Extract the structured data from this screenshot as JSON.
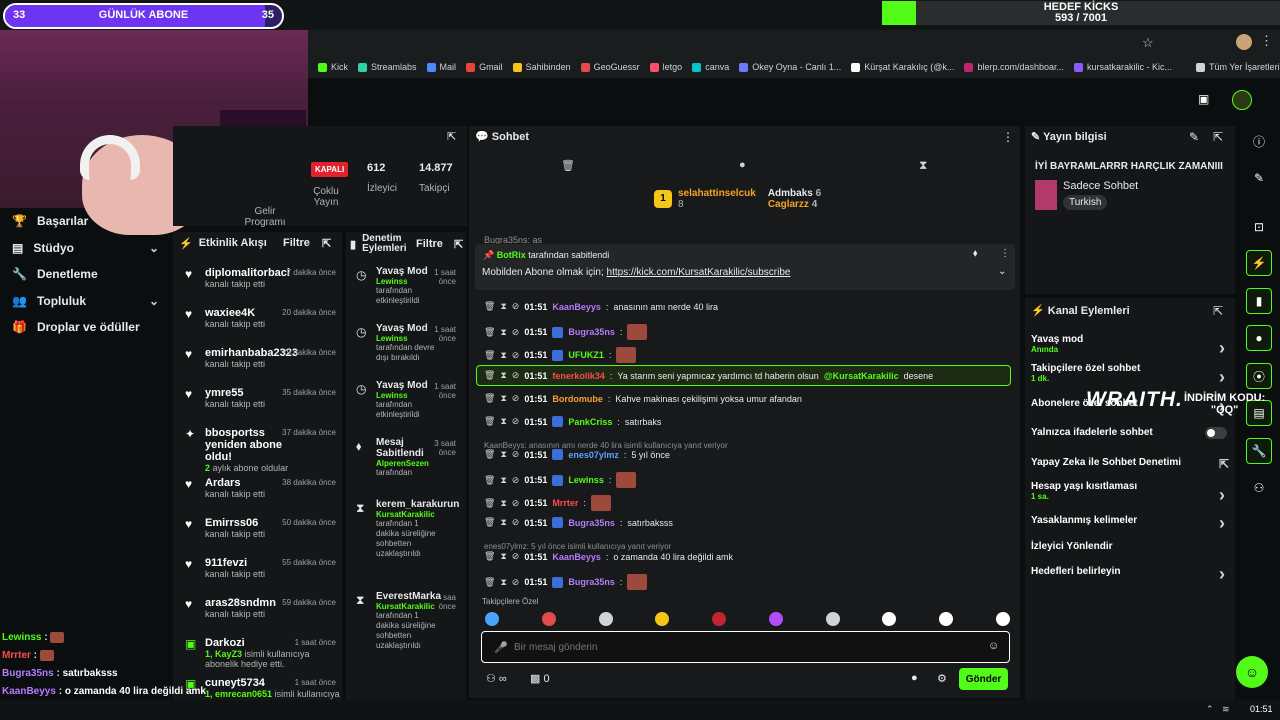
{
  "goal": {
    "title": "GÜNLÜK ABONE",
    "left": "33",
    "right": "35",
    "progress": 0.94
  },
  "kicks": {
    "title": "HEDEF KİCKS",
    "value": "593 / 7001",
    "progress": 0.085
  },
  "bookmarks": [
    "Kick",
    "Streamlabs",
    "Mail",
    "Gmail",
    "Sahibinden",
    "GeoGuessr",
    "letgo",
    "canva",
    "Okey Oyna - Canlı 1...",
    "Kürşat Karakılıç (@k...",
    "blerp.com/dashboar...",
    "kursatkarakilic - Kic...",
    "Tüm Yer İşaretleri"
  ],
  "stats": {
    "status": "KAPALI",
    "viewers": "612",
    "viewers_label": "İzleyici",
    "followers": "14.877",
    "followers_label": "Takipçi",
    "multi": "Çoklu Yayın",
    "income": "Gelir Programı"
  },
  "nav": [
    {
      "label": "Başarılar"
    },
    {
      "label": "Stüdyo"
    },
    {
      "label": "Denetleme"
    },
    {
      "label": "Topluluk"
    },
    {
      "label": "Droplar ve ödüller"
    }
  ],
  "events": {
    "title": "Etkinlik Akışı",
    "filter": "Filtre",
    "items": [
      {
        "name": "diplomalitorbaci",
        "sub": "kanalı takip etti",
        "time": "7 dakika önce"
      },
      {
        "name": "waxiee4K",
        "sub": "kanalı takip etti",
        "time": "20 dakika önce"
      },
      {
        "name": "emirhanbaba2323",
        "sub": "kanalı takip etti",
        "time": "29 dakika önce"
      },
      {
        "name": "ymre55",
        "sub": "kanalı takip etti",
        "time": "35 dakika önce"
      },
      {
        "name": "bbosportss yeniden abone oldu!",
        "sub": "aylık abone oldular",
        "sub_num": "2",
        "time": "37 dakika önce"
      },
      {
        "name": "Ardars",
        "sub": "kanalı takip etti",
        "time": "38 dakika önce"
      },
      {
        "name": "Emirrss06",
        "sub": "kanalı takip etti",
        "time": "50 dakika önce"
      },
      {
        "name": "911fevzi",
        "sub": "kanalı takip etti",
        "time": "55 dakika önce"
      },
      {
        "name": "aras28sndmn",
        "sub": "kanalı takip etti",
        "time": "59 dakika önce"
      },
      {
        "name": "Darkozi",
        "sub": "isimli kullanıcıya abonelik hediye etti.",
        "sub_num": "1, KayZ3",
        "time": "1 saat önce"
      },
      {
        "name": "cuneyt5734",
        "sub": "isimli kullanıcıya abonelik hediye etti.",
        "sub_num": "1, emrecan0651",
        "time": "1 saat önce"
      }
    ]
  },
  "mod": {
    "title": "Denetim Eylemleri",
    "filter": "Filtre",
    "items": [
      {
        "name": "Yavaş Mod",
        "user": "Lewinss",
        "sub": "tarafından etkinleştirildi",
        "time": "1 saat önce"
      },
      {
        "name": "Yavaş Mod",
        "user": "Lewinss",
        "sub": "tarafından devre dışı bırakıldı",
        "time": "1 saat önce"
      },
      {
        "name": "Yavaş Mod",
        "user": "Lewinss",
        "sub": "tarafından etkinleştirildi",
        "time": "1 saat önce"
      },
      {
        "name": "Mesaj Sabitlendi",
        "user": "AlperenSezen",
        "sub": "tarafından",
        "time": "3 saat önce"
      },
      {
        "name": "kerem_karakurun",
        "user": "KursatKarakilic",
        "sub": "tarafından 1 dakika süreliğine sohbetten uzaklaştırıldı",
        "time": ""
      },
      {
        "name": "EverestMarka",
        "user": "KursatKarakilic",
        "sub": "tarafından 1 dakika süreliğine sohbetten uzaklaştırıldı",
        "time": "saa önce"
      }
    ]
  },
  "chat": {
    "title": "Sohbet",
    "top_users": [
      {
        "name": "selahattinselcuk",
        "count": "8"
      },
      {
        "name": "Admbaks",
        "count": "6"
      },
      {
        "name": "Caglarzz",
        "count": "4"
      }
    ],
    "pinned": {
      "by": "BotRix",
      "by_label": "tarafından sabitlendi",
      "text": "Mobilden Abone olmak için;",
      "link": "https://kick.com/KursatKarakilic/subscribe"
    },
    "ghost": "Bugra35ns: as",
    "messages": [
      {
        "time": "01:51",
        "user": "KaanBeyys",
        "color": "#b57cff",
        "text": "anasının amı nerde 40 lira",
        "emote": false
      },
      {
        "time": "01:51",
        "user": "Bugra35ns",
        "color": "#b57cff",
        "text": "",
        "emote": true
      },
      {
        "time": "01:51",
        "user": "UFUKZ1",
        "color": "#53fc18",
        "text": "",
        "emote": true
      },
      {
        "time": "01:51",
        "user": "fenerkolik34",
        "color": "#ff4b4b",
        "text": "Ya starım seni yapmıcaz yardımcı td haberin olsun",
        "mention": "@KursatKarakilic",
        "tail": "desene",
        "highlight": true
      },
      {
        "time": "01:51",
        "user": "Bordomube",
        "color": "#ff9f2e",
        "text": "Kahve makinası çekilişimi yoksa umur afandan"
      },
      {
        "time": "01:51",
        "user": "PankCriss",
        "color": "#53fc18",
        "text": "satırbaks"
      },
      {
        "time": "01:51",
        "user": "enes07ylmz",
        "color": "#5aa3ff",
        "text": "5 yıl önce",
        "reply": "KaanBeyys: anasının amı nerde 40 lira isimli kullanıcıya yanıt veriyor"
      },
      {
        "time": "01:51",
        "user": "Lewinss",
        "color": "#53fc18",
        "text": "",
        "emote": true
      },
      {
        "time": "01:51",
        "user": "Mrrter",
        "color": "#ff4b4b",
        "text": "",
        "emote": true
      },
      {
        "time": "01:51",
        "user": "Bugra35ns",
        "color": "#b57cff",
        "text": "satırbaksss"
      },
      {
        "time": "01:51",
        "user": "KaanBeyys",
        "color": "#b57cff",
        "text": "o zamanda 40 lira değildi amk",
        "reply": "enes07ylmz: 5 yıl önce isimli kullanıcıya yanıt veriyor"
      },
      {
        "time": "01:51",
        "user": "Bugra35ns",
        "color": "#b57cff",
        "text": "",
        "emote": true
      }
    ],
    "emote_label": "Takipçilere Özel",
    "placeholder": "Bir mesaj gönderin",
    "send": "Gönder",
    "points": "0"
  },
  "info": {
    "title": "Yayın bilgisi",
    "stream_title": "İYİ BAYRAMLARRR HARÇLIK ZAMANIII",
    "mode": "Sadece Sohbet",
    "lang": "Turkish"
  },
  "actions": {
    "title": "Kanal Eylemleri",
    "items": [
      {
        "label": "Yavaş mod",
        "sub": "Anında"
      },
      {
        "label": "Takipçilere özel sohbet",
        "sub": "1 dk."
      },
      {
        "label": "Abonelere özel sohbet",
        "sub": ""
      },
      {
        "label": "Yalnızca ifadelerle sohbet",
        "sub": ""
      },
      {
        "label": "Yapay Zeka ile Sohbet Denetimi",
        "sub": ""
      },
      {
        "label": "Hesap yaşı kısıtlaması",
        "sub": "1 sa."
      },
      {
        "label": "Yasaklanmış kelimeler",
        "sub": ""
      },
      {
        "label": "İzleyici Yönlendir",
        "sub": ""
      },
      {
        "label": "Hedefleri belirleyin",
        "sub": ""
      }
    ]
  },
  "overlay": {
    "brand": "WRAITH.",
    "promo": "İNDİRİM KODU:",
    "code": "\"QQ\"",
    "chat": [
      {
        "user": "Lewinss",
        "color": "#53fc18",
        "text": ""
      },
      {
        "user": "Mrrter",
        "color": "#ff4b4b",
        "text": ""
      },
      {
        "user": "Bugra35ns",
        "color": "#b57cff",
        "text": "satırbaksss"
      },
      {
        "user": "KaanBeyys",
        "color": "#b57cff",
        "text": "o zamanda 40 lira değildi amk"
      },
      {
        "user": "Bugra35ns",
        "color": "#b57cff",
        "text": ""
      }
    ]
  },
  "clock": "01:51"
}
